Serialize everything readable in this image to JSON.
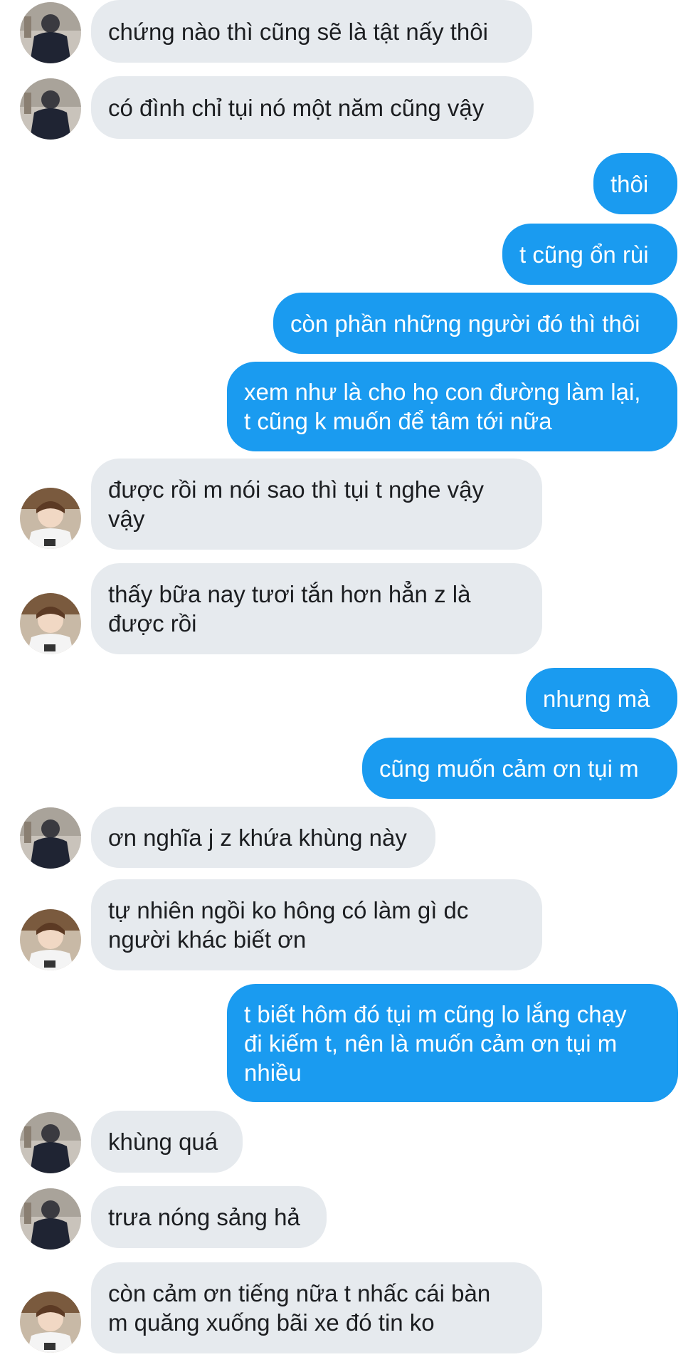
{
  "conversation": {
    "messages": [
      {
        "from": "friend_a",
        "text": "chứng nào thì cũng sẽ là tật nấy thôi"
      },
      {
        "from": "friend_a",
        "text": "có đình chỉ tụi nó một năm cũng vậy"
      },
      {
        "from": "me",
        "text": "thôi"
      },
      {
        "from": "me",
        "text": "t cũng ổn rùi"
      },
      {
        "from": "me",
        "text": "còn phần những người đó thì thôi"
      },
      {
        "from": "me",
        "lines": [
          "xem như là cho họ con đường làm lại,",
          "t cũng k muốn để tâm tới nữa"
        ]
      },
      {
        "from": "friend_b",
        "lines": [
          "được rồi m nói sao thì tụi t nghe vậy",
          "vậy"
        ]
      },
      {
        "from": "friend_b",
        "lines": [
          "thấy bữa nay tươi tắn hơn hẳn z là",
          "được rồi"
        ]
      },
      {
        "from": "me",
        "text": "nhưng mà"
      },
      {
        "from": "me",
        "text": "cũng muốn cảm ơn tụi m"
      },
      {
        "from": "friend_a",
        "text": "ơn nghĩa j z khứa khùng này"
      },
      {
        "from": "friend_b",
        "lines": [
          "tự nhiên ngồi ko hông có làm gì dc",
          "người khác biết ơn"
        ]
      },
      {
        "from": "me",
        "lines": [
          "t biết hôm đó tụi m cũng lo lắng chạy",
          "đi kiếm t, nên là muốn cảm ơn tụi m",
          "nhiều"
        ]
      },
      {
        "from": "friend_a",
        "text": "khùng quá"
      },
      {
        "from": "friend_a",
        "text": "trưa nóng sảng hả"
      },
      {
        "from": "friend_b",
        "lines": [
          "còn cảm ơn tiếng nữa t nhấc cái bàn",
          "m quăng xuống bãi xe đó tin ko"
        ]
      }
    ]
  },
  "colors": {
    "sent_bubble": "#1a9bf0",
    "received_bubble": "#e6eaee",
    "received_text": "#1c1e21",
    "sent_text": "#ffffff"
  },
  "avatars": {
    "friend_a": "avatar-dark-jacket",
    "friend_b": "avatar-white-shirt"
  }
}
